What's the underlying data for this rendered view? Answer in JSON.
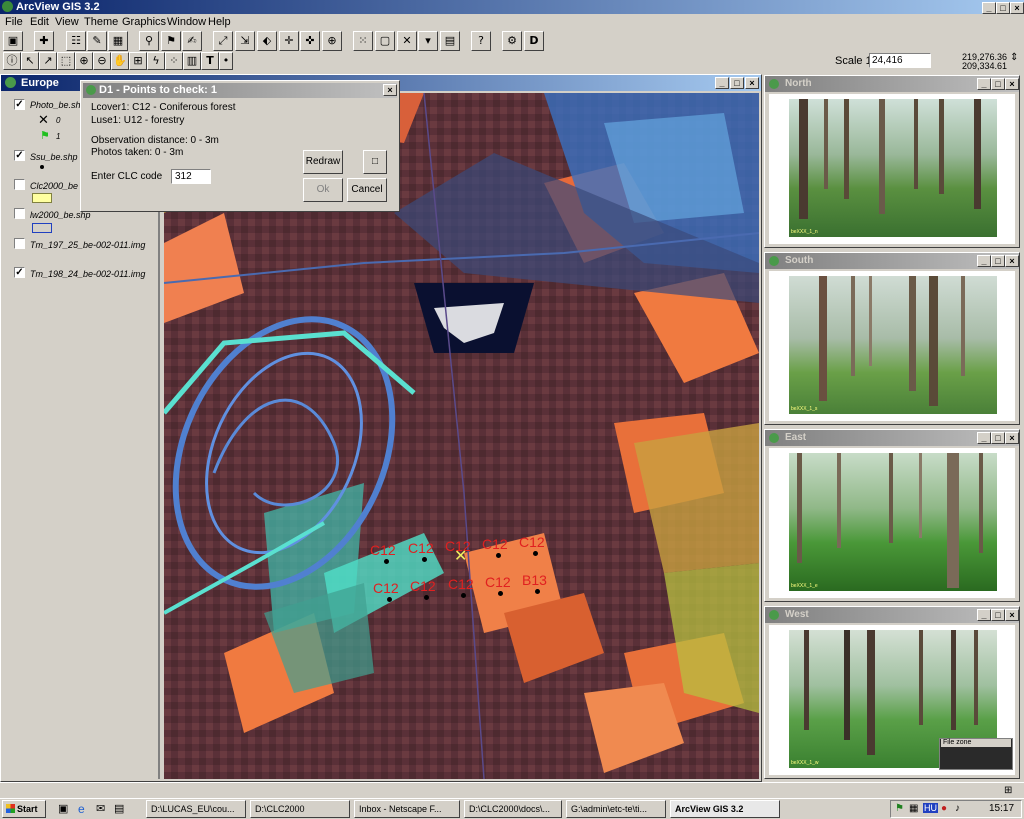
{
  "app": {
    "title": "ArcView GIS 3.2"
  },
  "menu": [
    "File",
    "Edit",
    "View",
    "Theme",
    "Graphics",
    "Window",
    "Help"
  ],
  "toolbar": {
    "d_label": "D",
    "scale_label": "Scale 1:",
    "scale_value": "24,416",
    "coord_x": "219,276.36",
    "coord_y": "209,334.61",
    "text_tool": "T"
  },
  "legend": {
    "title": "Europe",
    "entries": [
      {
        "name": "Photo_be.shp",
        "checked": true
      },
      {
        "name": "Ssu_be.shp",
        "checked": true
      },
      {
        "name": "Clc2000_be",
        "checked": false
      },
      {
        "name": "lw2000_be.shp",
        "checked": false
      },
      {
        "name": "Tm_197_25_be-002-011.img",
        "checked": false
      },
      {
        "name": "Tm_198_24_be-002-011.img",
        "checked": true
      }
    ],
    "photo_classes": [
      "0",
      "1"
    ]
  },
  "dialog": {
    "title": "D1 - Points to check: 1",
    "lcover": "Lcover1: C12 - Coniferous forest",
    "luse": "Luse1: U12 - forestry",
    "obs_dist": "Observation distance: 0 - 3m",
    "photos": "Photos taken: 0 - 3m",
    "clc_label": "Enter CLC code",
    "clc_value": "312",
    "redraw": "Redraw",
    "ok": "Ok",
    "cancel": "Cancel"
  },
  "map": {
    "labels_row1": [
      "C12",
      "C12",
      "C12",
      "C12",
      "C12"
    ],
    "labels_row2": [
      "C12",
      "C12",
      "C12",
      "C12",
      "B13"
    ]
  },
  "photos": [
    {
      "title": "North",
      "caption": "beXXX_1_n"
    },
    {
      "title": "South",
      "caption": "beXXX_1_s"
    },
    {
      "title": "East",
      "caption": "beXXX_1_e"
    },
    {
      "title": "West",
      "caption": "beXXX_1_w"
    }
  ],
  "file_zone": "File zone",
  "taskbar": {
    "start": "Start",
    "items": [
      "D:\\LUCAS_EU\\cou...",
      "D:\\CLC2000",
      "Inbox - Netscape F...",
      "D:\\CLC2000\\docs\\...",
      "G:\\admin\\etc-te\\ti...",
      "ArcView GIS 3.2"
    ],
    "tray_lang": "HU",
    "clock": "15:17"
  },
  "colors": {
    "title_active": "#0a246a",
    "map_label": "#e02020"
  }
}
